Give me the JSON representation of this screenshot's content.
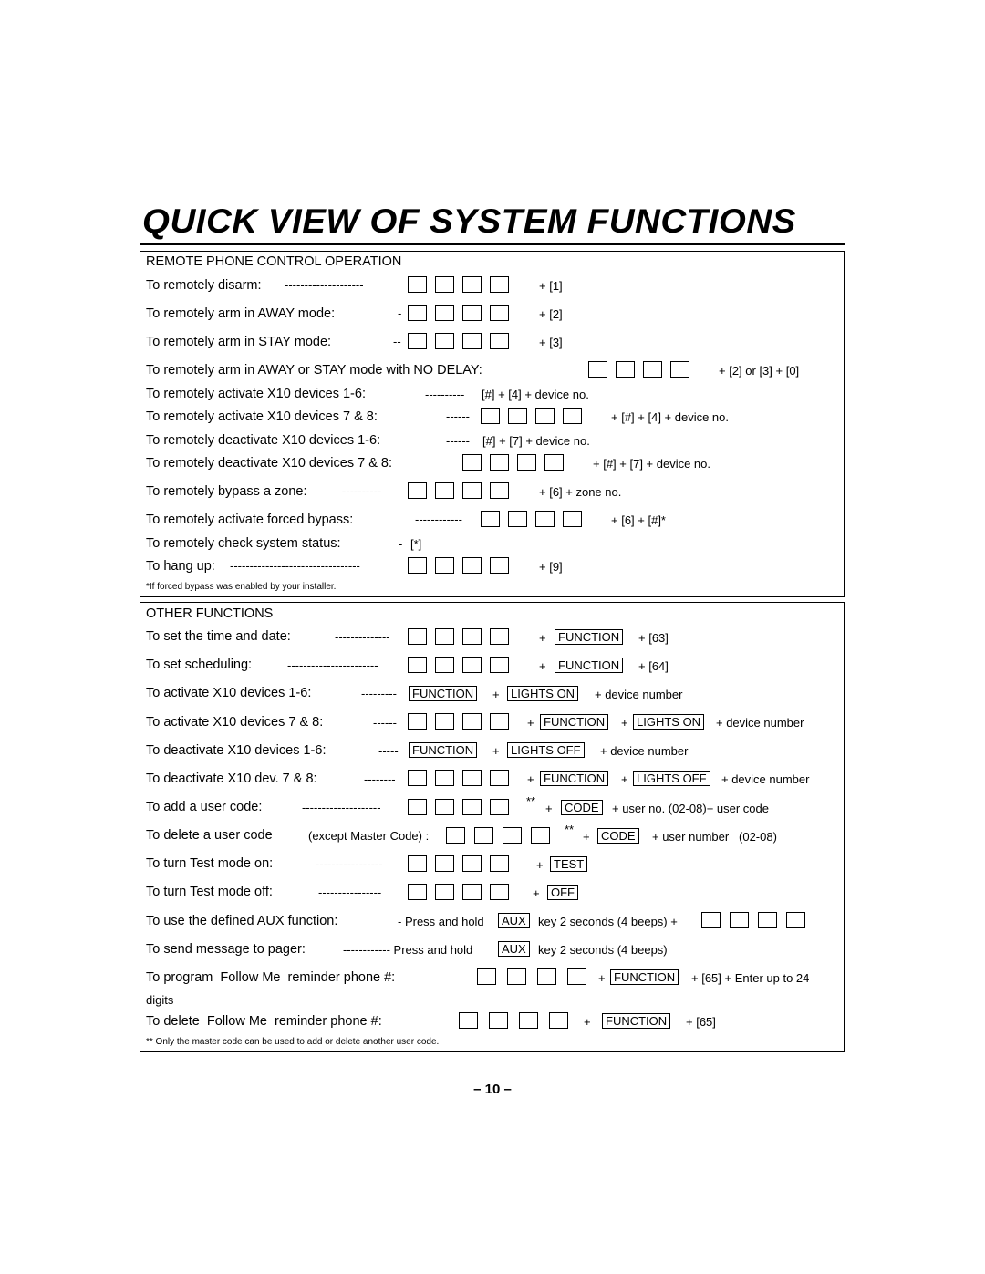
{
  "title": "QUICK VIEW OF SYSTEM FUNCTIONS",
  "page_number": "– 10 –",
  "remote": {
    "header": "REMOTE PHONE CONTROL OPERATION",
    "rows": [
      {
        "label": "To remotely disarm:",
        "dashes": "--------------------",
        "suffix": "+  [1]"
      },
      {
        "label": "To remotely arm in AWAY mode:",
        "dashes": "-",
        "suffix": "+  [2]"
      },
      {
        "label": "To remotely arm in STAY mode:",
        "dashes": "--",
        "suffix": "+  [3]"
      },
      {
        "label": "To remotely arm in AWAY or STAY mode with NO DELAY:",
        "dashes": "",
        "suffix": "+  [2] or [3] + [0]"
      },
      {
        "label": "To remotely activate X10 devices 1-6:",
        "dashes": "----------",
        "suffix": "[#] + [4] + device no."
      },
      {
        "label": "To remotely activate X10 devices 7 & 8:",
        "dashes": "------",
        "suffix": "+  [#] + [4] + device no."
      },
      {
        "label": "To remotely deactivate X10 devices 1-6:",
        "dashes": "------",
        "suffix": "[#] + [7] + device no."
      },
      {
        "label": "To remotely deactivate X10 devices 7 & 8:",
        "dashes": "",
        "suffix": "+  [#] + [7] + device no."
      },
      {
        "label": "To remotely bypass a zone:",
        "dashes": "----------",
        "suffix": "+  [6] + zone no."
      },
      {
        "label": "To remotely activate forced bypass:",
        "dashes": "------------",
        "suffix": "+  [6] + [#]*"
      },
      {
        "label": "To remotely check system status:",
        "dashes": "-",
        "suffix": "[*]"
      },
      {
        "label": "To hang up:",
        "dashes": "---------------------------------",
        "suffix": "+  [9]"
      }
    ],
    "footnote": "*If forced bypass was enabled by your installer."
  },
  "other": {
    "header": "OTHER FUNCTIONS",
    "rows": [
      {
        "label": "To set the time and date:",
        "dashes": "--------------",
        "plus1": "+",
        "btn1": "FUNCTION",
        "plus2": "+  [63]"
      },
      {
        "label": "To set scheduling:",
        "dashes": "-----------------------",
        "plus1": "+",
        "btn1": "FUNCTION",
        "plus2": "+  [64]"
      },
      {
        "label": "To activate X10 devices 1-6:",
        "dashes": "---------",
        "btn1": "FUNCTION",
        "plus1": "+",
        "btn2": "LIGHTS ON",
        "tail": "+ device number"
      },
      {
        "label": "To activate X10 devices 7 & 8:",
        "dashes": "------",
        "plus1": "+",
        "btn1": "FUNCTION",
        "plus2": "+",
        "btn2": "LIGHTS ON",
        "tail": "+ device number"
      },
      {
        "label": "To deactivate X10 devices 1-6:",
        "dashes": "-----",
        "btn1": "FUNCTION",
        "plus1": "+",
        "btn2": "LIGHTS OFF",
        "tail": "+ device number"
      },
      {
        "label": "To deactivate X10 dev. 7 & 8:",
        "dashes": "--------",
        "plus1": "+",
        "btn1": "FUNCTION",
        "plus2": "+",
        "btn2": "LIGHTS OFF",
        "tail": "+ device number"
      },
      {
        "label": "To add a user code:",
        "dashes": "--------------------",
        "stars": "**",
        "plus1": "+",
        "btn1": "CODE",
        "tail": "+ user no. (02-08)+ user code"
      },
      {
        "label": "To delete a user code",
        "note": "(except Master Code) :",
        "stars": "**",
        "plus1": "+",
        "btn1": "CODE",
        "tail": "+ user number   (02-08)"
      },
      {
        "label": "To turn Test mode on:",
        "dashes": "-----------------",
        "plus1": "+",
        "btn1": "TEST"
      },
      {
        "label": "To turn Test mode off:",
        "dashes": "----------------",
        "plus1": "+",
        "btn1": "OFF"
      },
      {
        "label": "To use the defined AUX function:",
        "pre": "- Press and hold",
        "btn1": "AUX",
        "mid": "key 2 seconds (4 beeps) +"
      },
      {
        "label": "To send message to pager:",
        "pre": "------------ Press and hold",
        "btn1": "AUX",
        "mid": "key 2 seconds (4 beeps)"
      },
      {
        "label": "To program  Follow Me  reminder phone #:",
        "plus1": "+",
        "btn1": "FUNCTION",
        "tail": "+ [65] + Enter up to 24",
        "wrap": "digits"
      },
      {
        "label": "To delete  Follow Me  reminder phone #:",
        "plus1": "+",
        "btn1": "FUNCTION",
        "tail": "+  [65]"
      }
    ],
    "footnote": "** Only the master code can be used to add or delete another user code."
  }
}
